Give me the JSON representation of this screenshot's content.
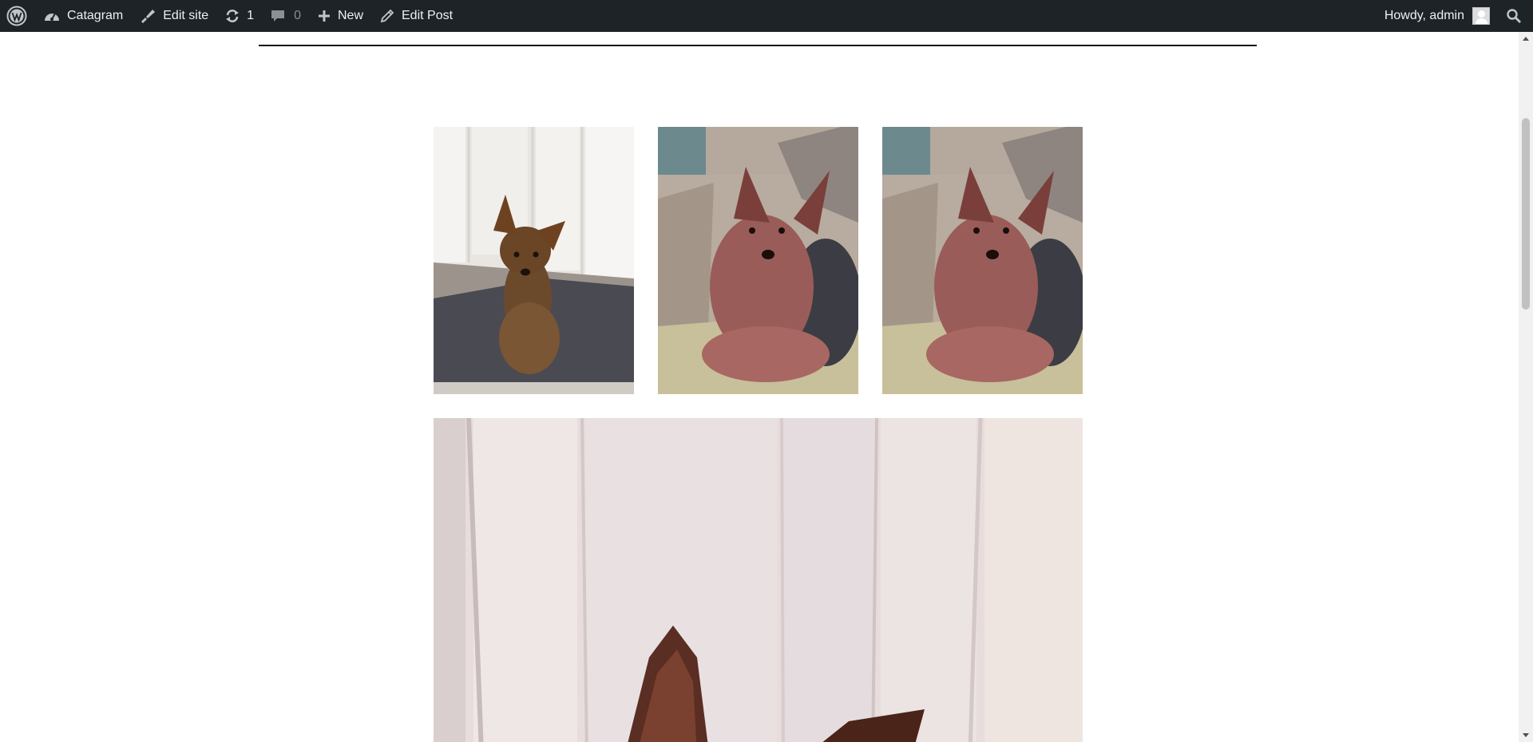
{
  "adminbar": {
    "site_name": "Catagram",
    "edit_site": "Edit site",
    "updates_count": "1",
    "comments_count": "0",
    "new_label": "New",
    "edit_post": "Edit Post",
    "greeting": "Howdy, admin"
  },
  "icons": {
    "wordpress": "wordpress-logo-icon",
    "dashboard": "dashboard-icon",
    "edit_site": "brush-icon",
    "updates": "refresh-icon",
    "comments": "comment-bubble-icon",
    "new": "plus-icon",
    "edit_post": "pencil-icon",
    "search": "search-icon"
  },
  "gallery": {
    "images": [
      {
        "subject": "yorkie-on-mat"
      },
      {
        "subject": "yorkie-on-couch"
      },
      {
        "subject": "yorkie-on-couch"
      },
      {
        "subject": "yorkie-ears-closeup"
      }
    ]
  },
  "colors": {
    "adminbar_bg": "#1d2327",
    "adminbar_text": "#f0f0f1",
    "page_bg": "#ffffff"
  }
}
